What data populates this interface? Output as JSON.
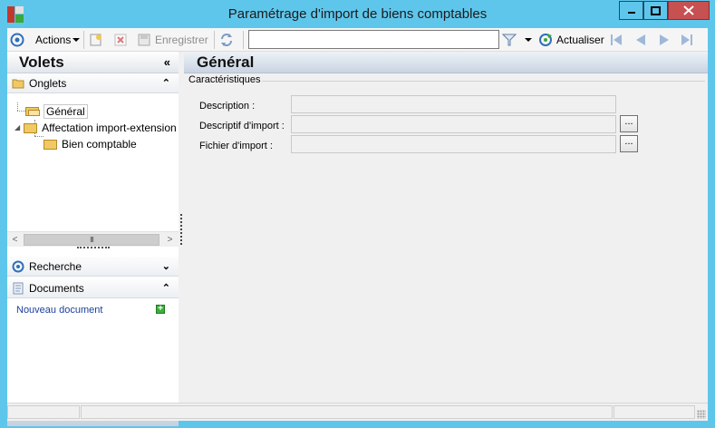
{
  "window": {
    "title": "Paramétrage d'import de biens comptables",
    "controls": [
      "minimize",
      "maximize",
      "close"
    ]
  },
  "toolbar": {
    "actions_label": "Actions",
    "save_label": "Enregistrer",
    "search_value": "",
    "refresh_label": "Actualiser",
    "icons": [
      "target-icon",
      "chevron-down-icon",
      "new-document-icon",
      "delete-icon",
      "save-icon",
      "sync-icon",
      "filter-icon",
      "refresh-icon",
      "first-icon",
      "previous-icon",
      "next-icon",
      "last-icon"
    ]
  },
  "left_panel": {
    "title": "Volets",
    "onglets": {
      "label": "Onglets",
      "tree": [
        {
          "label": "Général",
          "level": 0
        },
        {
          "label": "Affectation import-extension",
          "level": 0
        },
        {
          "label": "Bien comptable",
          "level": 1
        }
      ]
    },
    "scrollbar_thumb": "III",
    "recherche_label": "Recherche",
    "documents": {
      "label": "Documents",
      "new_document": "Nouveau document"
    }
  },
  "main": {
    "title": "Général",
    "group_title": "Caractéristiques",
    "fields": [
      {
        "label": "Description :",
        "value": "",
        "browse": false
      },
      {
        "label": "Descriptif d'import :",
        "value": "",
        "browse": true
      },
      {
        "label": "Fichier d'import :",
        "value": "",
        "browse": true
      }
    ],
    "browse_label": "..."
  },
  "colors": {
    "titlebar": "#5fc6eb",
    "close_button": "#c75050",
    "link": "#1a3f9c"
  }
}
